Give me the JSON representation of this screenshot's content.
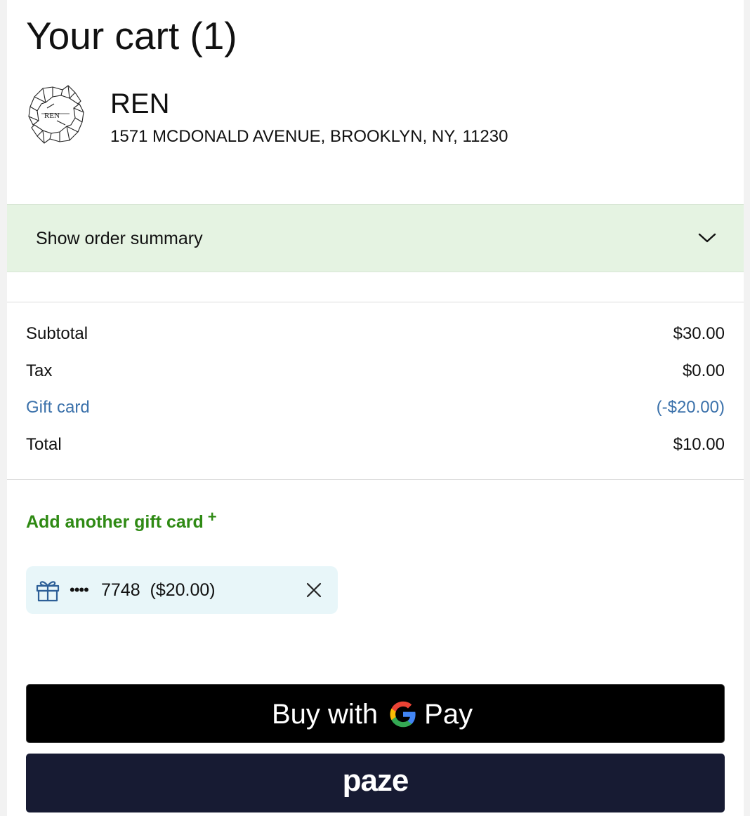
{
  "header": {
    "title": "Your cart (1)"
  },
  "store": {
    "logo_icon": "ren-koi-logo-icon",
    "name": "REN",
    "address": "1571 MCDONALD AVENUE, BROOKLYN, NY, 11230"
  },
  "order_summary": {
    "label": "Show order summary",
    "icon": "chevron-down-icon",
    "background": "#e5f3e2"
  },
  "totals": [
    {
      "label": "Subtotal",
      "value": "$30.00"
    },
    {
      "label": "Tax",
      "value": "$0.00"
    },
    {
      "label": "Gift card",
      "value": "(-$20.00)"
    },
    {
      "label": "Total",
      "value": "$10.00"
    }
  ],
  "gift_card": {
    "add_label": "Add another gift card",
    "add_icon": "+",
    "applied": {
      "masked": "••••",
      "text": "7748  ($20.00)",
      "icon": "gift-icon",
      "remove_icon": "close-icon"
    }
  },
  "payment": {
    "gpay": {
      "buy_label": "Buy with",
      "pay_label": "Pay",
      "logo": "google-g-icon"
    },
    "paze": {
      "label": "paze"
    }
  },
  "colors": {
    "link_blue": "#3c72ab",
    "add_green": "#2f8a14",
    "gift_chip_bg": "#e8f6f9",
    "paze_bg": "#171b33",
    "gpay_bg": "#000000"
  }
}
